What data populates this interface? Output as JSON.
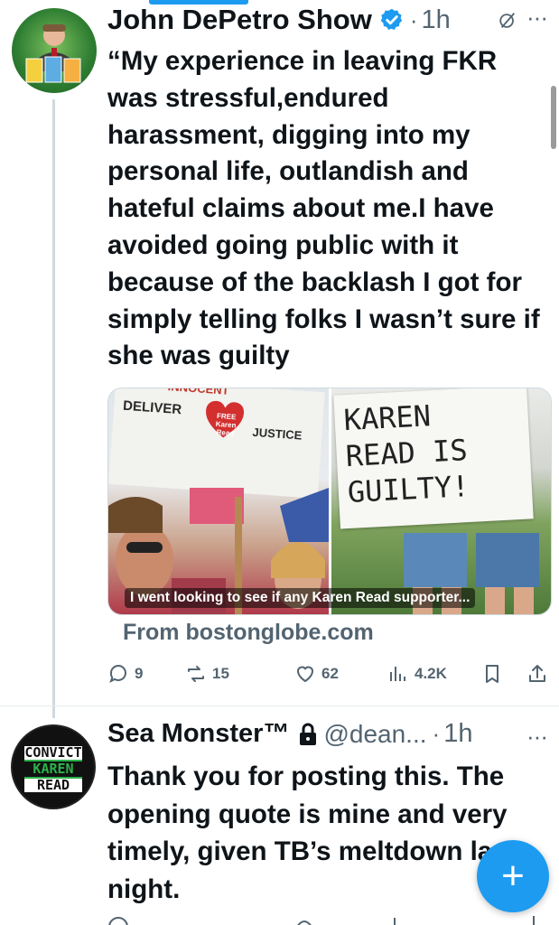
{
  "tweet1": {
    "author": "John DePetro Show",
    "dot": "·",
    "time": "1h",
    "more": "···",
    "text": "“My experience in leaving FKR was stressful,endured harassment, digging into my personal life, outlandish and hateful claims about me.I have avoided going public with it because of the backlash I got for simply telling folks I wasn’t sure if she was guilty",
    "media": {
      "caption": "I went looking to see if any Karen Read supporter...",
      "left_sign": {
        "top": "INNOCENT",
        "deliver": "DELIVER",
        "heart": "FREE Karen Read",
        "justice": "JUSTICE"
      },
      "right_sign": {
        "line1": "KAREN",
        "line2": "READ IS",
        "line3": "GUILTY!"
      }
    },
    "source": "From bostonglobe.com",
    "actions": {
      "replies": "9",
      "reposts": "15",
      "likes": "62",
      "views": "4.2K"
    }
  },
  "tweet2": {
    "author": "Sea Monster™",
    "handle": "@dean...",
    "dot": "·",
    "time": "1h",
    "more": "···",
    "avatar_text": {
      "line1": "CONVICT",
      "line2": "KAREN",
      "line3": "READ"
    },
    "text": "Thank you for posting this. The opening quote is mine and very timely, given TB’s meltdown last night."
  },
  "fab": {
    "label": "+"
  },
  "colors": {
    "accent": "#1d9bf0",
    "secondary_text": "#536471",
    "text": "#0f1419"
  }
}
